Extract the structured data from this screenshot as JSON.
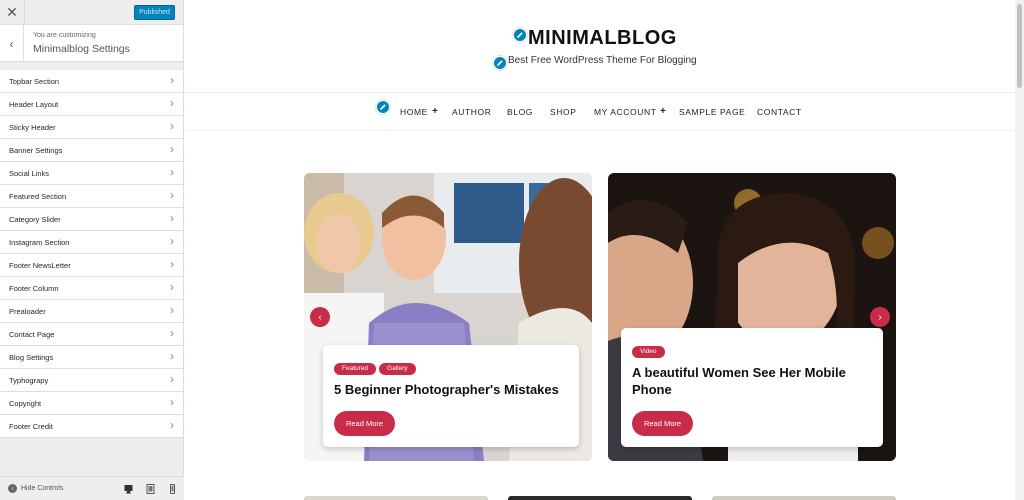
{
  "customizer": {
    "close_glyph": "✕",
    "publish_label": "Published",
    "back_glyph": "‹",
    "subtitle": "You are customizing",
    "title": "Minimalblog Settings",
    "sections": [
      {
        "label": "Topbar Section",
        "marker": "1"
      },
      {
        "label": "Header Layout",
        "marker": "2"
      },
      {
        "label": "Sticky Header",
        "marker": "3"
      },
      {
        "label": "Banner Settings",
        "marker": "4"
      },
      {
        "label": "Social Links",
        "marker": "5"
      },
      {
        "label": "Featured Section",
        "marker": "6"
      },
      {
        "label": "Category Slider",
        "marker": "7"
      },
      {
        "label": "Instagram Section",
        "marker": "8"
      },
      {
        "label": "Footer NewsLetter",
        "marker": "9"
      },
      {
        "label": "Footer Column",
        "marker": "11"
      },
      {
        "label": "Prealoader",
        "marker": "12"
      },
      {
        "label": "Contact Page",
        "marker": "13"
      },
      {
        "label": "Blog Settings",
        "marker": "14"
      },
      {
        "label": "Typhograpy",
        "marker": "15"
      },
      {
        "label": "Copyright",
        "marker": "16"
      },
      {
        "label": "Footer Credit",
        "marker": "17"
      }
    ],
    "hide_controls_label": "Hide Controls",
    "device_icons": [
      "desktop-icon",
      "tablet-icon",
      "mobile-icon"
    ]
  },
  "site": {
    "title": "MINIMALBLOG",
    "tagline": "Best Free WordPress Theme For Blogging",
    "nav": [
      {
        "label": "HOME",
        "has_plus": true
      },
      {
        "label": "AUTHOR",
        "has_plus": false
      },
      {
        "label": "BLOG",
        "has_plus": false
      },
      {
        "label": "SHOP",
        "has_plus": false
      },
      {
        "label": "MY ACCOUNT",
        "has_plus": true
      },
      {
        "label": "SAMPLE PAGE",
        "has_plus": false
      },
      {
        "label": "CONTACT",
        "has_plus": false
      }
    ],
    "plus_glyph": "+",
    "slides": [
      {
        "tags": [
          "Featured",
          "Gallery"
        ],
        "title": "5 Beginner Photographer's Mistakes",
        "button": "Read More"
      },
      {
        "tags": [
          "Video"
        ],
        "title": "A beautiful Women See Her Mobile Phone",
        "button": "Read More"
      }
    ],
    "prev_glyph": "‹",
    "next_glyph": "›"
  },
  "colors": {
    "accent": "#c82c48",
    "publish": "#0085ba"
  }
}
